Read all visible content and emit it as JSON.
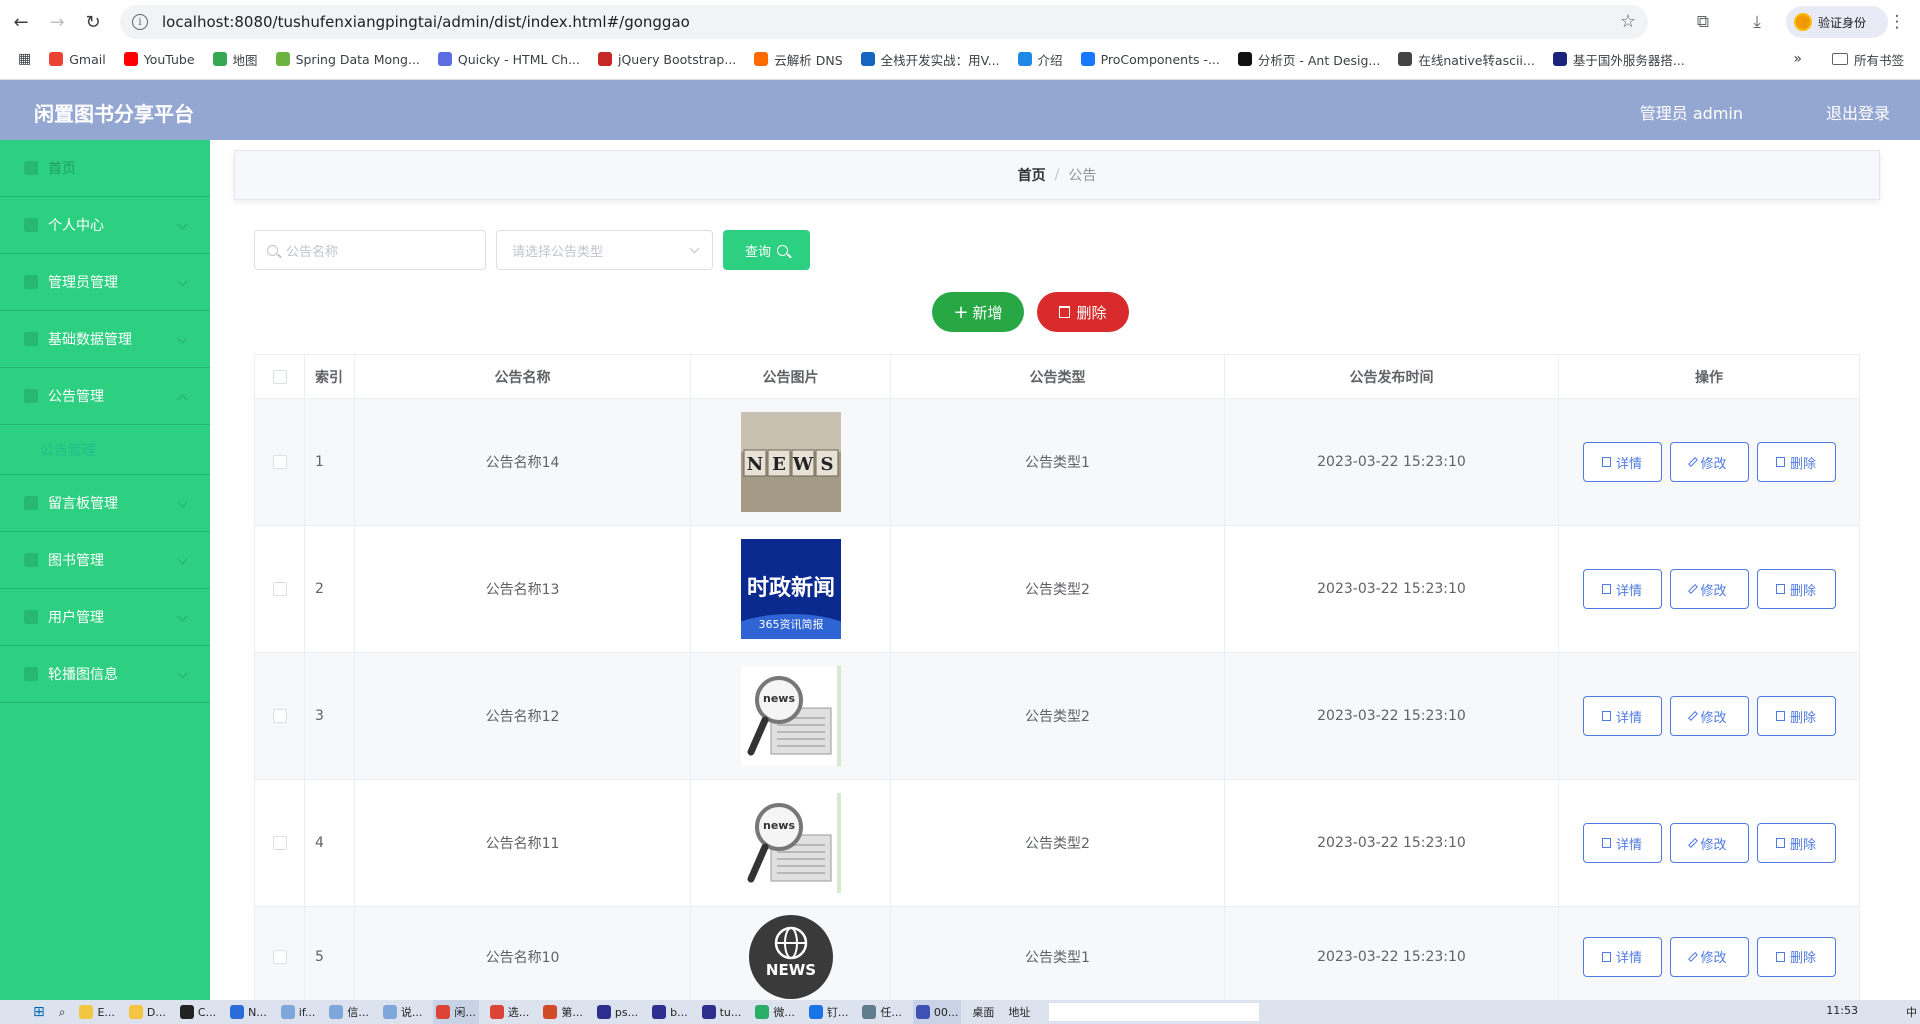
{
  "browser": {
    "url": "localhost:8080/tushufenxiangpingtai/admin/dist/index.html#/gonggao",
    "verify_label": "验证身份",
    "bookmarks": [
      {
        "label": "Gmail",
        "color": "#ea4335"
      },
      {
        "label": "YouTube",
        "color": "#ff0000"
      },
      {
        "label": "地图",
        "color": "#34a853"
      },
      {
        "label": "Spring Data Mong...",
        "color": "#6db33f"
      },
      {
        "label": "Quicky - HTML Ch...",
        "color": "#5b6ee1"
      },
      {
        "label": "jQuery Bootstrap...",
        "color": "#c62828"
      },
      {
        "label": "云解析 DNS",
        "color": "#ff6a00"
      },
      {
        "label": "全栈开发实战：用V...",
        "color": "#1565c0"
      },
      {
        "label": "介绍",
        "color": "#1e88e5"
      },
      {
        "label": "ProComponents -...",
        "color": "#1677ff"
      },
      {
        "label": "分析页 - Ant Desig...",
        "color": "#111111"
      },
      {
        "label": "在线native转ascii...",
        "color": "#444444"
      },
      {
        "label": "基于国外服务器搭...",
        "color": "#1a237e"
      }
    ],
    "more_bookmarks": "»",
    "all_bookmarks": "所有书签"
  },
  "header": {
    "title": "闲置图书分享平台",
    "admin": "管理员 admin",
    "logout": "退出登录"
  },
  "sidebar": {
    "items": [
      {
        "label": "首页"
      },
      {
        "label": "个人中心"
      },
      {
        "label": "管理员管理"
      },
      {
        "label": "基础数据管理"
      },
      {
        "label": "公告管理"
      },
      {
        "label": "留言板管理"
      },
      {
        "label": "图书管理"
      },
      {
        "label": "用户管理"
      },
      {
        "label": "轮播图信息"
      }
    ],
    "sub_item": "公告管理"
  },
  "breadcrumb": {
    "home": "首页",
    "separator": "/",
    "current": "公告"
  },
  "search": {
    "name_placeholder": "公告名称",
    "type_placeholder": "请选择公告类型",
    "query_label": "查询"
  },
  "actions": {
    "add_label": "新增",
    "delete_label": "删除"
  },
  "table": {
    "headers": {
      "index": "索引",
      "name": "公告名称",
      "image": "公告图片",
      "type": "公告类型",
      "time": "公告发布时间",
      "ops": "操作"
    },
    "rows": [
      {
        "index": "1",
        "name": "公告名称14",
        "image": "news-blocks",
        "type": "公告类型1",
        "time": "2023-03-22 15:23:10"
      },
      {
        "index": "2",
        "name": "公告名称13",
        "image": "politics-news",
        "image_text": "时政新闻",
        "image_subtext": "365资讯简报",
        "type": "公告类型2",
        "time": "2023-03-22 15:23:10"
      },
      {
        "index": "3",
        "name": "公告名称12",
        "image": "magnifier-news",
        "image_text": "news",
        "type": "公告类型2",
        "time": "2023-03-22 15:23:10"
      },
      {
        "index": "4",
        "name": "公告名称11",
        "image": "magnifier-news",
        "image_text": "news",
        "type": "公告类型2",
        "time": "2023-03-22 15:23:10"
      },
      {
        "index": "5",
        "name": "公告名称10",
        "image": "globe-news",
        "image_text": "NEWS",
        "type": "公告类型1",
        "time": "2023-03-22 15:23:10"
      }
    ],
    "op_labels": {
      "detail": "详情",
      "edit": "修改",
      "delete": "删除"
    }
  },
  "taskbar": {
    "items": [
      "E...",
      "D...",
      "C...",
      "N...",
      "if...",
      "信...",
      "说...",
      "闲...",
      "选...",
      "第...",
      "ps...",
      "b...",
      "tu...",
      "微...",
      "钉...",
      "任...",
      "00..."
    ],
    "desktop": "桌面",
    "address": "地址",
    "ime": "中",
    "time": "11:53"
  }
}
